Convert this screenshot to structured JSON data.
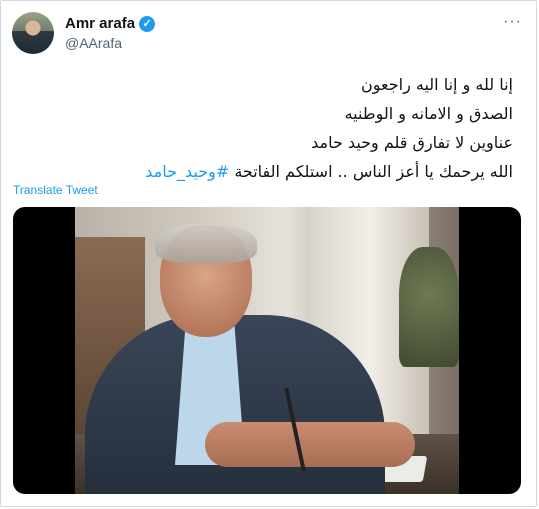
{
  "tweet": {
    "author_name": "Amr arafa",
    "handle": "@AArafa",
    "more_label": "···",
    "verified_label": "✓",
    "lines": [
      "إنا لله و إنا اليه راجعون",
      "الصدق و الامانه و الوطنيه",
      "عناوين لا تفارق قلم وحيد حامد"
    ],
    "last_line_text": "الله يرحمك يا أعز الناس .. استلكم الفاتحة",
    "hashtag": "#وحيد_حامد",
    "translate_label": "Translate Tweet"
  },
  "colors": {
    "accent": "#1d9bf0",
    "text": "#0f1419",
    "secondary": "#536471",
    "border": "#cfd9de"
  },
  "icons": {
    "verified": "verified-badge-icon",
    "more": "more-icon"
  }
}
